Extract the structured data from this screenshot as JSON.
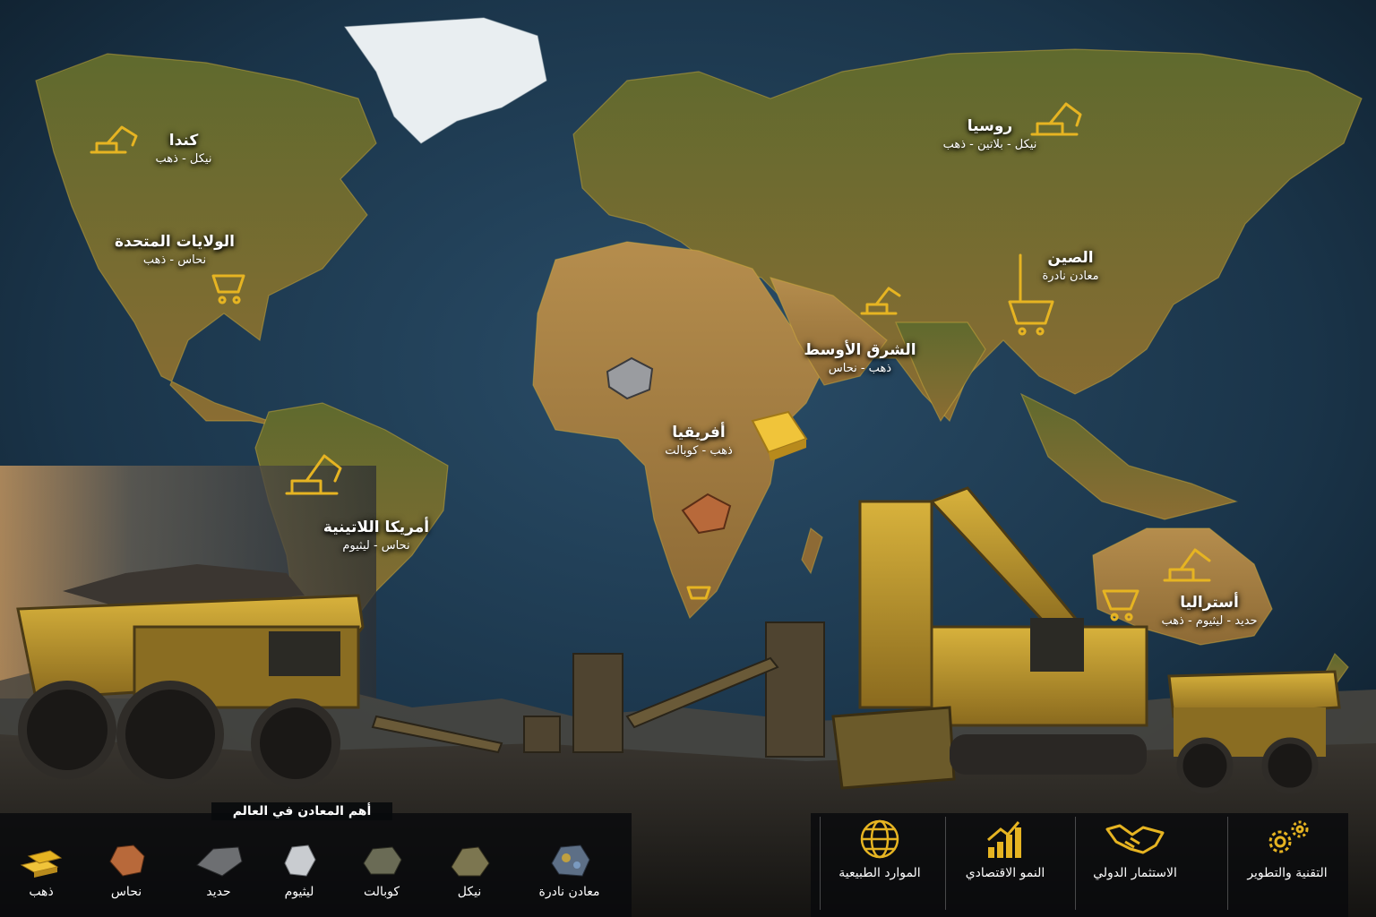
{
  "regions": [
    {
      "name": "كندا",
      "minerals": "نيكل - ذهب"
    },
    {
      "name": "الولايات المتحدة",
      "minerals": "نحاس - ذهب"
    },
    {
      "name": "روسيا",
      "minerals": "نيكل - بلاتين - ذهب"
    },
    {
      "name": "الصين",
      "minerals": "معادن نادرة"
    },
    {
      "name": "الشرق الأوسط",
      "minerals": "ذهب - نحاس"
    },
    {
      "name": "أفريقيا",
      "minerals": "ذهب - كوبالت"
    },
    {
      "name": "أمريكا اللاتينية",
      "minerals": "نحاس - ليثيوم"
    },
    {
      "name": "أستراليا",
      "minerals": "حديد - ليثيوم - ذهب"
    }
  ],
  "legend": {
    "title": "أهم المعادن في العالم",
    "items": [
      {
        "label": "ذهب",
        "color": "#e6b422"
      },
      {
        "label": "نحاس",
        "color": "#b8693a"
      },
      {
        "label": "حديد",
        "color": "#6d6f72"
      },
      {
        "label": "ليثيوم",
        "color": "#c9ccd0"
      },
      {
        "label": "كوبالت",
        "color": "#6a6b55"
      },
      {
        "label": "نيكل",
        "color": "#7c7650"
      },
      {
        "label": "معادن نادرة",
        "color": "#5d6f86"
      }
    ]
  },
  "features": [
    {
      "icon": "globe-icon",
      "label": "الموارد الطبيعية"
    },
    {
      "icon": "growth-chart-icon",
      "label": "النمو الاقتصادي"
    },
    {
      "icon": "handshake-icon",
      "label": "الاستثمار الدولي"
    },
    {
      "icon": "gears-icon",
      "label": "التقنية والتطوير"
    }
  ],
  "colors": {
    "accent": "#e6b422",
    "ocean": "#1d3a52",
    "land": "#8a6d33"
  }
}
